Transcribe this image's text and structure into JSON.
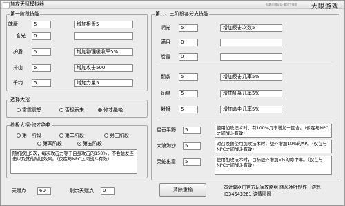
{
  "window": {
    "title": "加攻天赋模拟器",
    "logo_text": "大眼游戏",
    "logo_sub": "仙路问道论坛·翻译工作室"
  },
  "tier1": {
    "title": "第一阶段技能",
    "rows": [
      {
        "name": "魄蜃",
        "value": "5",
        "desc": "增加根骨5"
      },
      {
        "name": "含光",
        "value": "0",
        "desc": ""
      },
      {
        "name": "护盾",
        "value": "5",
        "desc": "增加物理吸收率5%"
      },
      {
        "name": "排山",
        "value": "5",
        "desc": "增加攻击500"
      },
      {
        "name": "千钧",
        "value": "5",
        "desc": "增加力量5"
      }
    ]
  },
  "tier23": {
    "title": "第二、三阶段各分支技能",
    "rows": [
      {
        "name": "溯光",
        "value": "5",
        "desc": "增加反击次数5"
      },
      {
        "name": "满月",
        "value": "0",
        "desc": ""
      },
      {
        "name": "卷霞",
        "value": "0",
        "desc": ""
      },
      {
        "name": "翻袭",
        "value": "5",
        "desc": "增加反击几率5%"
      },
      {
        "name": "灿星",
        "value": "5",
        "desc": "增加狂暴几率5%"
      },
      {
        "name": "射狮",
        "value": "5",
        "desc": "增加命中几率5%"
      },
      {
        "name": "星垂平野",
        "value": "5",
        "desc": "使用加攻法术时，有100%几率增加一回合。（仅在与NPC之间战斗有效）"
      },
      {
        "name": "大浪淘沙",
        "value": "5",
        "desc": "对召唤兽使用加攻法术时，额外增加10%的AP。（仅在与NPC之间战斗有效）"
      },
      {
        "name": "灵蛇出窟",
        "value": "5",
        "desc": "使用加攻法术时，目标额外增加5%的命中率。（仅在与NPC之间战斗有效）"
      }
    ]
  },
  "big_move": {
    "title": "选择大招",
    "options": [
      {
        "label": "雷霆震怒",
        "selected": false
      },
      {
        "label": "否极泰来",
        "selected": false
      },
      {
        "label": "修才绝艳",
        "selected": true
      }
    ]
  },
  "final_move": {
    "title": "终极大招-修才绝艳",
    "options": [
      {
        "label": "第一阶段",
        "selected": false
      },
      {
        "label": "第二阶段",
        "selected": false
      },
      {
        "label": "第三阶段",
        "selected": false
      },
      {
        "label": "第四阶段",
        "selected": false
      },
      {
        "label": "第五阶段",
        "selected": true
      }
    ],
    "desc": "随机欲出5次，每次攻击力等于自身攻击的150%，不会触发连击以及其他附加效果。（仅在与NPC之间战斗有效）"
  },
  "footer": {
    "points_label": "天赋点",
    "points_value": "60",
    "remaining_label": "剩余天赋点",
    "remaining_value": "0",
    "reset_label": "清除重输",
    "credit": "本计算器由官方玩家攻略组·随风冰叶制作，游戏ID34643261 详情圈圈"
  }
}
